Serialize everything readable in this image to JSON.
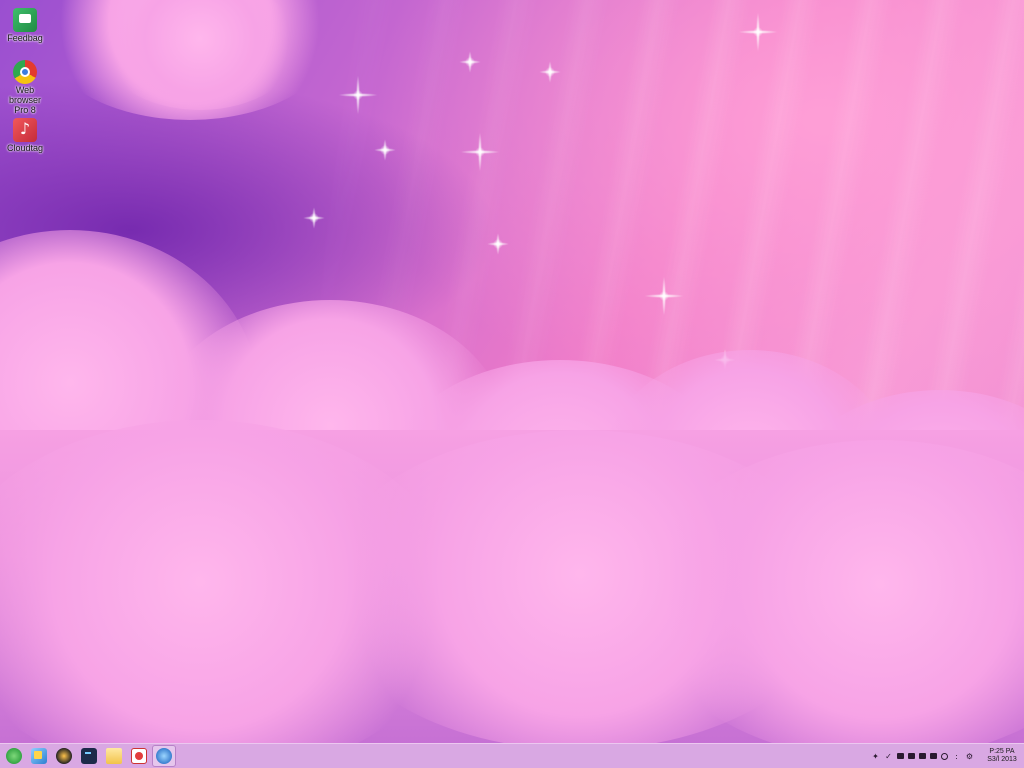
{
  "desktop": {
    "icons": [
      {
        "label": "Feedbag",
        "icon": "feedback-icon"
      },
      {
        "label": "Web browser Pro 8",
        "icon": "browser-icon"
      },
      {
        "label": "Cloudtag",
        "icon": "music-icon"
      }
    ]
  },
  "taskbar": {
    "apps": [
      {
        "icon": "start-orb-icon"
      },
      {
        "icon": "file-manager-icon"
      },
      {
        "icon": "clock-app-icon"
      },
      {
        "icon": "terminal-icon"
      },
      {
        "icon": "folder-icon"
      },
      {
        "icon": "paint-icon"
      },
      {
        "icon": "web-globe-icon"
      }
    ],
    "tray": {
      "icons": [
        "arrow-icon",
        "pen-icon",
        "battery-icon",
        "network-icon",
        "display-icon",
        "keyboard-icon",
        "help-icon",
        "info-icon",
        "settings-icon"
      ],
      "clock_line1": "P:25 PA",
      "clock_line2": "S3/l 2013"
    }
  },
  "colors": {
    "taskbar_bg": "#d9a8e3",
    "accent_purple": "#6c22aa",
    "accent_pink": "#f7a3e6"
  }
}
